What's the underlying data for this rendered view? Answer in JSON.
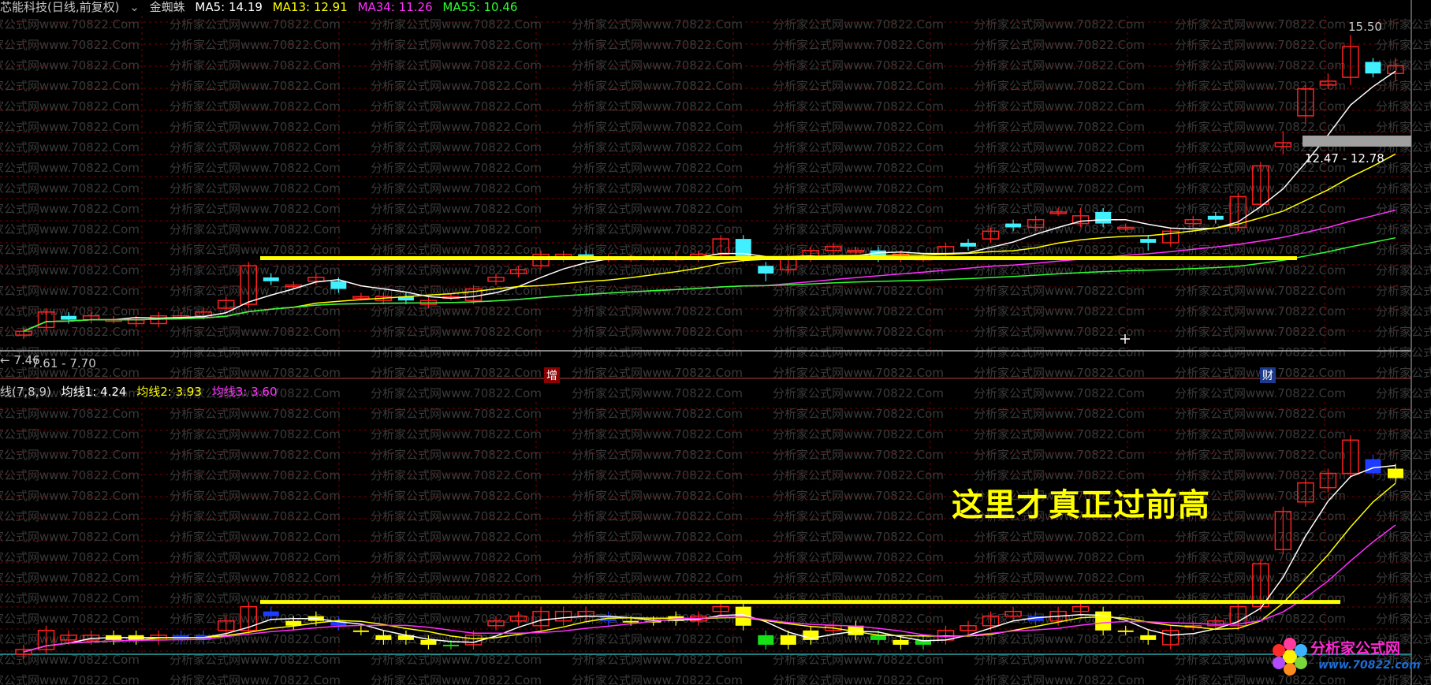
{
  "header_top": {
    "stock_name": "芯能科技(日线,前复权)",
    "indicator_name": "金蜘蛛",
    "ma5": "MA5: 14.19",
    "ma13": "MA13: 12.91",
    "ma34": "MA34: 11.26",
    "ma55": "MA55: 10.46"
  },
  "header_bottom": {
    "indicator": "线(7,8,9)",
    "line1": "均线1: 4.24",
    "line2": "均线2: 3.93",
    "line3": "均线3: 3.60"
  },
  "labels": {
    "price_high": "15.50",
    "price_low": "← 7.46",
    "range_high": "12.47 - 12.78",
    "range_low": "7.61 - 7.70",
    "tag_zeng": "增",
    "tag_cai": "财",
    "annotation": "这里才真正过前高",
    "logo_text": "分析家公式网",
    "logo_url": "www.70822.com",
    "watermark": "分析家公式网www.70822.Com"
  },
  "colors": {
    "up": "#ff2020",
    "down": "#40f0ff",
    "ma5": "#ffffff",
    "ma13": "#ffff00",
    "ma34": "#ff30ff",
    "ma55": "#30ff30",
    "grid": "#7a0000",
    "highlight": "#ffff00"
  },
  "chart_data": {
    "type": "candlestick",
    "price_panel": {
      "ylim": [
        7.4,
        15.8
      ],
      "resistance_level": 9.5,
      "candles": [
        [
          7.5,
          7.6,
          7.4,
          7.7
        ],
        [
          7.7,
          8.1,
          7.6,
          8.2
        ],
        [
          8.0,
          7.9,
          7.8,
          8.1
        ],
        [
          7.9,
          8.0,
          7.8,
          8.1
        ],
        [
          7.9,
          7.9,
          7.8,
          8.0
        ],
        [
          7.8,
          7.9,
          7.7,
          8.0
        ],
        [
          7.8,
          8.0,
          7.7,
          8.1
        ],
        [
          8.0,
          8.0,
          7.9,
          8.1
        ],
        [
          8.0,
          8.1,
          7.9,
          8.2
        ],
        [
          8.2,
          8.4,
          8.1,
          8.5
        ],
        [
          8.3,
          9.3,
          8.2,
          9.4
        ],
        [
          9.0,
          8.9,
          8.8,
          9.1
        ],
        [
          8.8,
          8.8,
          8.7,
          8.9
        ],
        [
          8.9,
          9.0,
          8.8,
          9.1
        ],
        [
          8.9,
          8.7,
          8.6,
          9.0
        ],
        [
          8.5,
          8.5,
          8.4,
          8.6
        ],
        [
          8.4,
          8.5,
          8.3,
          8.6
        ],
        [
          8.5,
          8.4,
          8.3,
          8.6
        ],
        [
          8.3,
          8.4,
          8.2,
          8.5
        ],
        [
          8.5,
          8.5,
          8.4,
          8.6
        ],
        [
          8.4,
          8.7,
          8.3,
          8.8
        ],
        [
          8.9,
          9.0,
          8.8,
          9.1
        ],
        [
          9.1,
          9.2,
          9.0,
          9.3
        ],
        [
          9.3,
          9.6,
          9.2,
          9.7
        ],
        [
          9.5,
          9.6,
          9.4,
          9.7
        ],
        [
          9.6,
          9.5,
          9.4,
          9.7
        ],
        [
          9.5,
          9.5,
          9.4,
          9.6
        ],
        [
          9.5,
          9.5,
          9.4,
          9.6
        ],
        [
          9.5,
          9.5,
          9.4,
          9.6
        ],
        [
          9.5,
          9.5,
          9.4,
          9.7
        ],
        [
          9.5,
          9.6,
          9.4,
          9.7
        ],
        [
          9.6,
          10.0,
          9.5,
          10.1
        ],
        [
          10.0,
          9.5,
          9.4,
          10.1
        ],
        [
          9.3,
          9.1,
          8.9,
          9.4
        ],
        [
          9.2,
          9.5,
          9.1,
          9.6
        ],
        [
          9.5,
          9.7,
          9.4,
          9.8
        ],
        [
          9.7,
          9.8,
          9.6,
          9.9
        ],
        [
          9.7,
          9.7,
          9.6,
          9.8
        ],
        [
          9.7,
          9.5,
          9.4,
          9.8
        ],
        [
          9.5,
          9.6,
          9.4,
          9.7
        ],
        [
          9.5,
          9.5,
          9.4,
          9.6
        ],
        [
          9.6,
          9.8,
          9.5,
          9.9
        ],
        [
          9.9,
          9.8,
          9.7,
          10.0
        ],
        [
          10.0,
          10.2,
          9.9,
          10.3
        ],
        [
          10.4,
          10.3,
          10.2,
          10.5
        ],
        [
          10.3,
          10.5,
          10.2,
          10.6
        ],
        [
          10.7,
          10.7,
          10.6,
          10.8
        ],
        [
          10.4,
          10.6,
          10.3,
          10.8
        ],
        [
          10.7,
          10.4,
          10.3,
          10.8
        ],
        [
          10.3,
          10.3,
          10.2,
          10.4
        ],
        [
          10.0,
          9.9,
          9.7,
          10.1
        ],
        [
          9.9,
          10.2,
          9.8,
          10.3
        ],
        [
          10.4,
          10.5,
          10.3,
          10.6
        ],
        [
          10.6,
          10.5,
          10.4,
          10.7
        ],
        [
          10.3,
          11.1,
          10.2,
          11.2
        ],
        [
          10.9,
          11.9,
          10.8,
          12.0
        ],
        [
          12.4,
          12.5,
          12.2,
          12.8
        ],
        [
          13.2,
          13.9,
          13.0,
          14.0
        ],
        [
          14.0,
          14.1,
          13.9,
          14.3
        ],
        [
          14.2,
          15.0,
          14.0,
          15.3
        ],
        [
          14.6,
          14.3,
          14.2,
          14.7
        ],
        [
          14.3,
          14.5,
          14.1,
          14.7
        ]
      ]
    },
    "indicator_panel": {
      "ylim": [
        0,
        5.3
      ],
      "resistance_level": 1.0,
      "bars": [
        [
          0.0,
          0.1,
          "up"
        ],
        [
          0.1,
          0.5,
          "up"
        ],
        [
          0.4,
          0.3,
          "up"
        ],
        [
          0.3,
          0.4,
          "up"
        ],
        [
          0.4,
          0.3,
          "yellow"
        ],
        [
          0.3,
          0.4,
          "yellow"
        ],
        [
          0.4,
          0.3,
          "up"
        ],
        [
          0.3,
          0.4,
          "blue"
        ],
        [
          0.3,
          0.4,
          "blue"
        ],
        [
          0.5,
          0.7,
          "up"
        ],
        [
          0.5,
          1.0,
          "up"
        ],
        [
          0.9,
          0.8,
          "blue"
        ],
        [
          0.7,
          0.6,
          "yellow"
        ],
        [
          0.7,
          0.8,
          "yellow"
        ],
        [
          0.7,
          0.6,
          "blue"
        ],
        [
          0.5,
          0.5,
          "yellow"
        ],
        [
          0.4,
          0.3,
          "yellow"
        ],
        [
          0.4,
          0.3,
          "yellow"
        ],
        [
          0.3,
          0.2,
          "yellow"
        ],
        [
          0.2,
          0.2,
          "green"
        ],
        [
          0.2,
          0.4,
          "up"
        ],
        [
          0.6,
          0.7,
          "up"
        ],
        [
          0.7,
          0.8,
          "up"
        ],
        [
          0.6,
          0.9,
          "up"
        ],
        [
          0.7,
          0.9,
          "up"
        ],
        [
          0.8,
          0.9,
          "up"
        ],
        [
          0.8,
          0.7,
          "blue"
        ],
        [
          0.7,
          0.7,
          "yellow"
        ],
        [
          0.7,
          0.7,
          "yellow"
        ],
        [
          0.8,
          0.7,
          "yellow"
        ],
        [
          0.7,
          0.8,
          "up"
        ],
        [
          0.9,
          1.0,
          "up"
        ],
        [
          1.0,
          0.6,
          "yellow"
        ],
        [
          0.4,
          0.2,
          "green"
        ],
        [
          0.2,
          0.4,
          "yellow"
        ],
        [
          0.3,
          0.5,
          "yellow"
        ],
        [
          0.5,
          0.6,
          "up"
        ],
        [
          0.6,
          0.4,
          "yellow"
        ],
        [
          0.4,
          0.3,
          "green"
        ],
        [
          0.3,
          0.2,
          "yellow"
        ],
        [
          0.2,
          0.3,
          "green"
        ],
        [
          0.3,
          0.5,
          "up"
        ],
        [
          0.5,
          0.6,
          "up"
        ],
        [
          0.6,
          0.8,
          "up"
        ],
        [
          0.8,
          0.9,
          "up"
        ],
        [
          0.8,
          0.7,
          "blue"
        ],
        [
          0.7,
          0.9,
          "up"
        ],
        [
          1.0,
          0.9,
          "up"
        ],
        [
          0.9,
          0.5,
          "yellow"
        ],
        [
          0.5,
          0.5,
          "yellow"
        ],
        [
          0.4,
          0.3,
          "yellow"
        ],
        [
          0.2,
          0.5,
          "up"
        ],
        [
          0.6,
          0.6,
          "up"
        ],
        [
          0.7,
          0.6,
          "up"
        ],
        [
          0.6,
          1.0,
          "up"
        ],
        [
          1.0,
          1.9,
          "up"
        ],
        [
          2.2,
          3.0,
          "up"
        ],
        [
          3.2,
          3.6,
          "up"
        ],
        [
          3.5,
          3.8,
          "up"
        ],
        [
          3.8,
          4.5,
          "up"
        ],
        [
          4.1,
          3.8,
          "blue"
        ],
        [
          3.9,
          3.7,
          "yellow"
        ]
      ]
    }
  }
}
